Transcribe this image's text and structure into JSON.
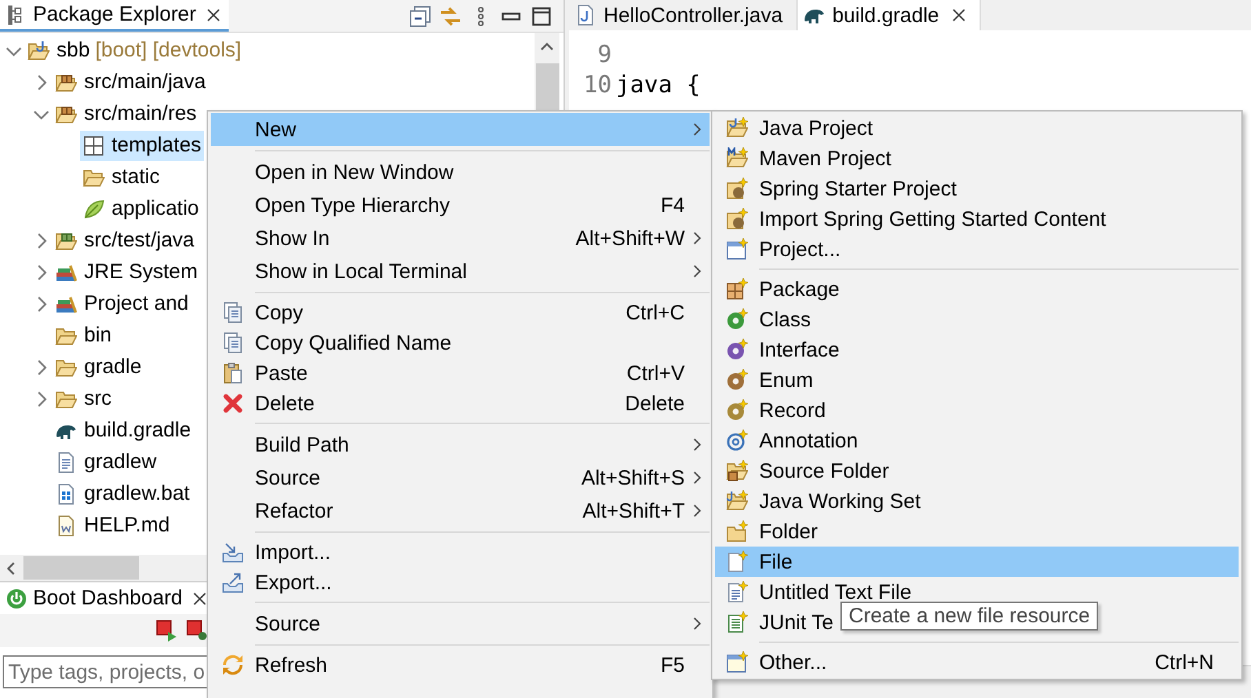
{
  "explorer": {
    "tab": {
      "title": "Package Explorer"
    },
    "tree": [
      {
        "label": "sbb",
        "decoration": "[boot] [devtools]",
        "expanded": true,
        "selected": false,
        "children": [
          {
            "label": "src/main/java",
            "expanded": false,
            "selected": false
          },
          {
            "label": "src/main/res",
            "expanded": true,
            "selected": false,
            "children": [
              {
                "label": "templates",
                "selected": true
              },
              {
                "label": "static",
                "selected": false
              },
              {
                "label": "applicatio",
                "selected": false
              }
            ]
          },
          {
            "label": "src/test/java",
            "expanded": false,
            "selected": false
          },
          {
            "label": "JRE System",
            "expanded": false,
            "selected": false
          },
          {
            "label": "Project and",
            "expanded": false,
            "selected": false
          },
          {
            "label": "bin",
            "selected": false
          },
          {
            "label": "gradle",
            "expanded": false,
            "selected": false
          },
          {
            "label": "src",
            "expanded": false,
            "selected": false
          },
          {
            "label": "build.gradle",
            "selected": false
          },
          {
            "label": "gradlew",
            "selected": false
          },
          {
            "label": "gradlew.bat",
            "selected": false
          },
          {
            "label": "HELP.md",
            "selected": false
          }
        ]
      }
    ]
  },
  "boot_dashboard": {
    "tab": {
      "title": "Boot Dashboard"
    },
    "search": {
      "placeholder": "Type tags, projects, o"
    }
  },
  "editor": {
    "tabs": [
      {
        "title": "HelloController.java",
        "selected": false
      },
      {
        "title": "build.gradle",
        "selected": true
      }
    ],
    "lines": [
      {
        "number": "9"
      },
      {
        "number": "10",
        "code": "java {"
      }
    ]
  },
  "context_menu": {
    "groups": [
      [
        {
          "label": "New",
          "submenu": true,
          "selected": true
        }
      ],
      [
        {
          "label": "Open in New Window",
          "submenu": false,
          "selected": false
        },
        {
          "label": "Open Type Hierarchy",
          "shortcut": "F4",
          "submenu": false,
          "selected": false
        },
        {
          "label": "Show In",
          "shortcut": "Alt+Shift+W",
          "submenu": true,
          "selected": false
        },
        {
          "label": "Show in Local Terminal",
          "submenu": true,
          "selected": false
        }
      ],
      [
        {
          "label": "Copy",
          "shortcut": "Ctrl+C",
          "submenu": false,
          "selected": false
        },
        {
          "label": "Copy Qualified Name",
          "submenu": false,
          "selected": false
        },
        {
          "label": "Paste",
          "shortcut": "Ctrl+V",
          "submenu": false,
          "selected": false
        },
        {
          "label": "Delete",
          "shortcut": "Delete",
          "submenu": false,
          "selected": false
        }
      ],
      [
        {
          "label": "Build Path",
          "submenu": true,
          "selected": false
        },
        {
          "label": "Source",
          "shortcut": "Alt+Shift+S",
          "submenu": true,
          "selected": false
        },
        {
          "label": "Refactor",
          "shortcut": "Alt+Shift+T",
          "submenu": true,
          "selected": false
        }
      ],
      [
        {
          "label": "Import...",
          "submenu": false,
          "selected": false
        },
        {
          "label": "Export...",
          "submenu": false,
          "selected": false
        }
      ],
      [
        {
          "label": "Source",
          "submenu": true,
          "selected": false
        }
      ],
      [
        {
          "label": "Refresh",
          "shortcut": "F5",
          "submenu": false,
          "selected": false
        }
      ]
    ]
  },
  "submenu": {
    "groups": [
      [
        {
          "label": "Java Project",
          "selected": false
        },
        {
          "label": "Maven Project",
          "selected": false
        },
        {
          "label": "Spring Starter Project",
          "selected": false
        },
        {
          "label": "Import Spring Getting Started Content",
          "selected": false
        },
        {
          "label": "Project...",
          "selected": false
        }
      ],
      [
        {
          "label": "Package",
          "selected": false
        },
        {
          "label": "Class",
          "selected": false
        },
        {
          "label": "Interface",
          "selected": false
        },
        {
          "label": "Enum",
          "selected": false
        },
        {
          "label": "Record",
          "selected": false
        },
        {
          "label": "Annotation",
          "selected": false
        },
        {
          "label": "Source Folder",
          "selected": false
        },
        {
          "label": "Java Working Set",
          "selected": false
        },
        {
          "label": "Folder",
          "selected": false
        },
        {
          "label": "File",
          "selected": true
        },
        {
          "label": "Untitled Text File",
          "selected": false
        },
        {
          "label": "JUnit Te",
          "selected": false
        }
      ],
      [
        {
          "label": "Other...",
          "shortcut": "Ctrl+N",
          "selected": false
        }
      ]
    ]
  },
  "tooltip": {
    "text": "Create a new file resource"
  }
}
